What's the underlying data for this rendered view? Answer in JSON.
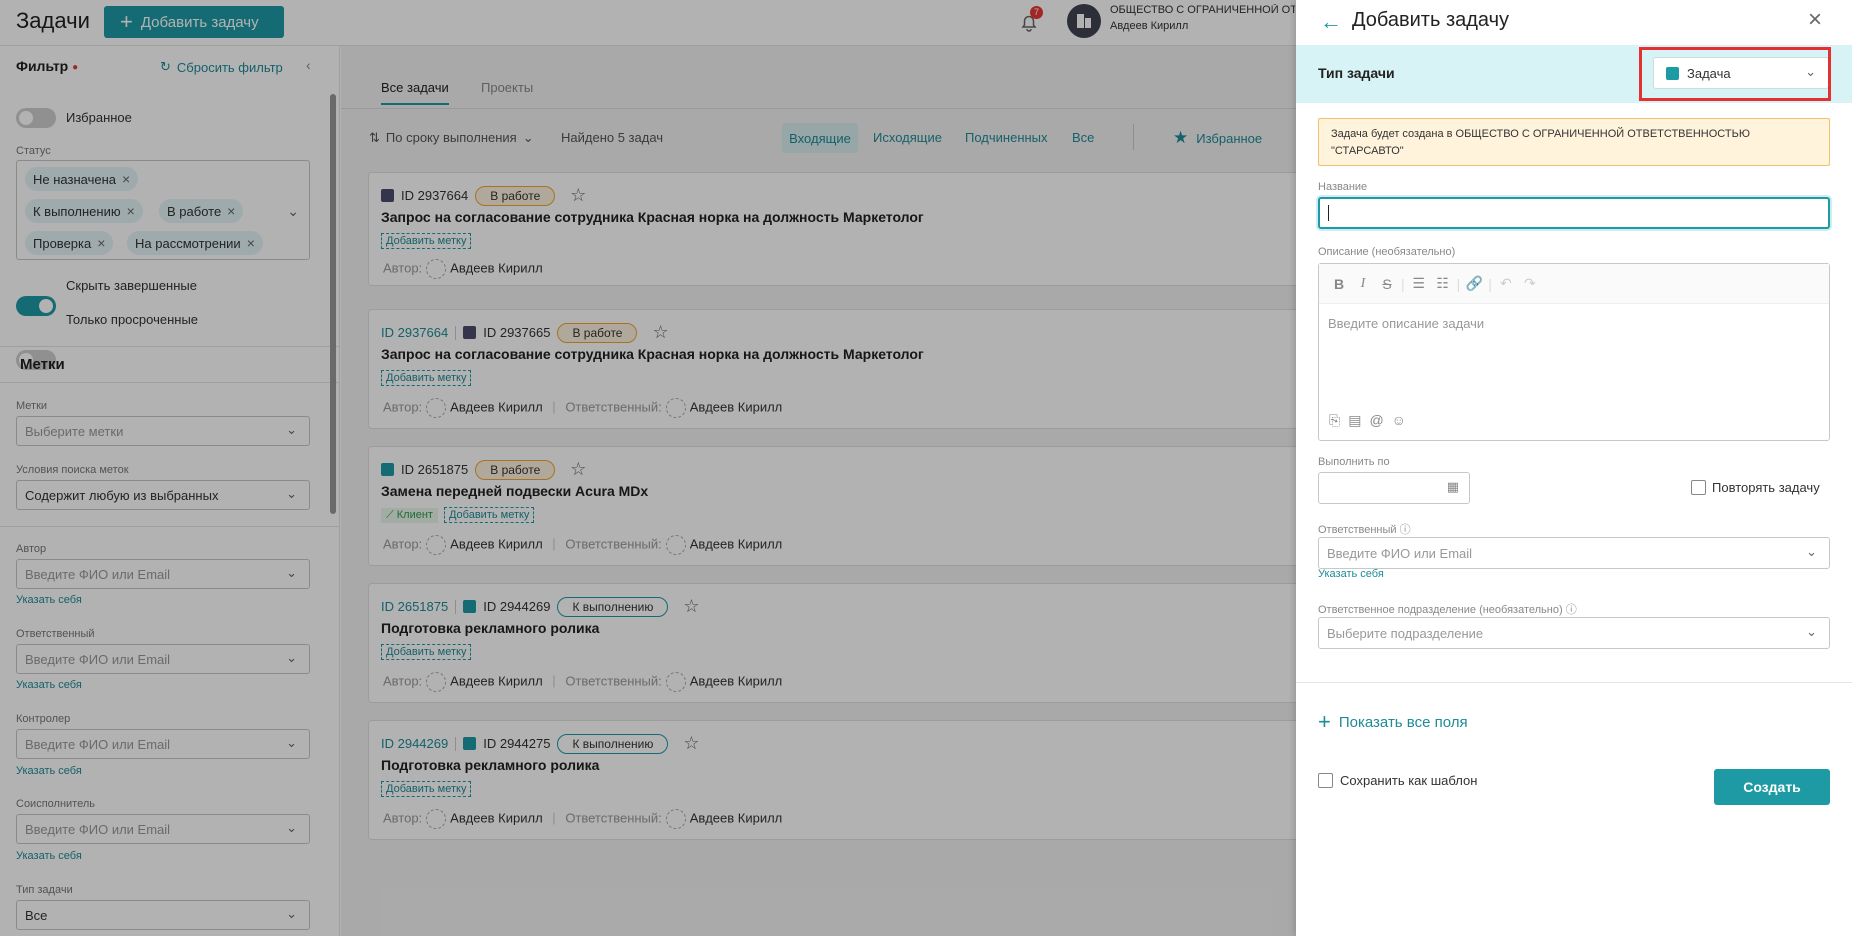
{
  "header": {
    "app_title": "Задачи",
    "add_button": "Добавить задачу",
    "notifications_count": "7",
    "org_name": "ОБЩЕСТВО С ОГРАНИЧЕННОЙ ОТВЕТСТВЕННОСТЬЮ",
    "user_name": "Авдеев Кирилл"
  },
  "sidebar": {
    "filter_title": "Фильтр",
    "reset_filter": "Сбросить фильтр",
    "favorites_label": "Избранное",
    "status_label": "Статус",
    "status_chips": [
      "Не назначена",
      "К выполнению",
      "В работе",
      "Проверка",
      "На рассмотрении"
    ],
    "hide_completed_label": "Скрыть завершенные",
    "only_overdue_label": "Только просроченные",
    "tags_section": "Метки",
    "tags_label": "Метки",
    "tags_placeholder": "Выберите метки",
    "tag_search_label": "Условия поиска меток",
    "tag_search_value": "Содержит любую из выбранных",
    "author_label": "Автор",
    "author_placeholder": "Введите ФИО или Email",
    "responsible_label": "Ответственный",
    "responsible_placeholder": "Введите ФИО или Email",
    "controller_label": "Контролер",
    "controller_placeholder": "Введите ФИО или Email",
    "coexecutor_label": "Соисполнитель",
    "coexecutor_placeholder": "Введите ФИО или Email",
    "self_link": "Указать себя",
    "task_type_label": "Тип задачи",
    "task_type_value": "Все"
  },
  "main": {
    "tabs": [
      "Все задачи",
      "Проекты"
    ],
    "sort_label": "По сроку выполнения",
    "found_label": "Найдено 5 задач",
    "filters": [
      "Входящие",
      "Исходящие",
      "Подчиненных",
      "Все"
    ],
    "favorites": "Избранное",
    "add_tag": "Добавить метку",
    "author_prefix": "Автор:",
    "responsible_prefix": "Ответственный:",
    "client_tag": "Клиент",
    "tasks": [
      {
        "parent": "",
        "id": "ID 2937664",
        "status": "В работе",
        "title": "Запрос на согласование сотрудника Красная норка на должность Маркетолог",
        "author": "Авдеев Кирилл",
        "responsible": ""
      },
      {
        "parent": "ID 2937664",
        "id": "ID 2937665",
        "status": "В работе",
        "title": "Запрос на согласование сотрудника Красная норка на должность Маркетолог",
        "author": "Авдеев Кирилл",
        "responsible": "Авдеев Кирилл"
      },
      {
        "parent": "",
        "id": "ID 2651875",
        "status": "В работе",
        "title": "Замена передней подвески Acura MDx",
        "author": "Авдеев Кирилл",
        "responsible": "Авдеев Кирилл"
      },
      {
        "parent": "ID 2651875",
        "id": "ID 2944269",
        "status": "К выполнению",
        "title": "Подготовка рекламного ролика",
        "author": "Авдеев Кирилл",
        "responsible": "Авдеев Кирилл"
      },
      {
        "parent": "ID 2944269",
        "id": "ID 2944275",
        "status": "К выполнению",
        "title": "Подготовка рекламного ролика",
        "author": "Авдеев Кирилл",
        "responsible": "Авдеев Кирилл"
      }
    ]
  },
  "panel": {
    "title": "Добавить задачу",
    "type_label": "Тип задачи",
    "type_value": "Задача",
    "notice_prefix": "Задача будет создана в",
    "notice_org": "ОБЩЕСТВО С ОГРАНИЧЕННОЙ ОТВЕТСТВЕННОСТЬЮ \"СТАРСАВТО\"",
    "name_label": "Название",
    "description_label": "Описание (необязательно)",
    "description_placeholder": "Введите описание задачи",
    "due_label": "Выполнить по",
    "repeat_label": "Повторять задачу",
    "responsible_label": "Ответственный",
    "responsible_placeholder": "Введите ФИО или Email",
    "self_link": "Указать себя",
    "dept_label": "Ответственное подразделение (необязательно)",
    "dept_placeholder": "Выберите подразделение",
    "show_all_fields": "Показать все поля",
    "save_template": "Сохранить как шаблон",
    "create_button": "Создать"
  },
  "colors": {
    "accent": "#1e9aa5",
    "highlight_frame": "#e53030",
    "status_orange": "#f0a430"
  }
}
